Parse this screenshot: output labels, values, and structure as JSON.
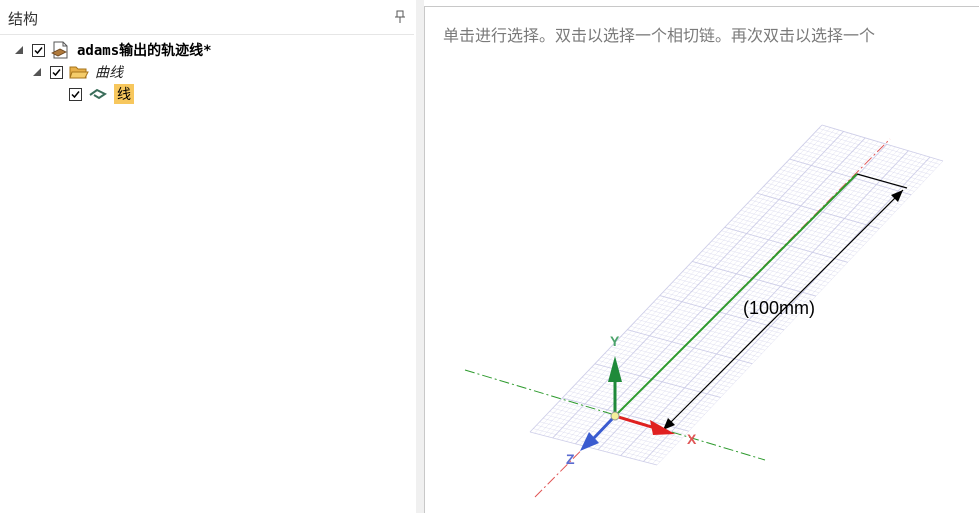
{
  "panel": {
    "title": "结构"
  },
  "tree": {
    "root_label": "adams输出的轨迹线*",
    "group_label": "曲线",
    "item_label": "线"
  },
  "viewport": {
    "hint": "单击进行选择。双击以选择一个相切链。再次双击以选择一个",
    "dimension_label": "(100mm)",
    "axis_x": "X",
    "axis_y": "Y",
    "axis_z": "Z"
  },
  "colors": {
    "selection_highlight": "#f7c75d",
    "curve_line": "#2d9a2d",
    "axis_x": "#e02020",
    "axis_y": "#1f8a3a",
    "axis_z": "#3a5bd0",
    "grid": "#c9c9e6"
  }
}
